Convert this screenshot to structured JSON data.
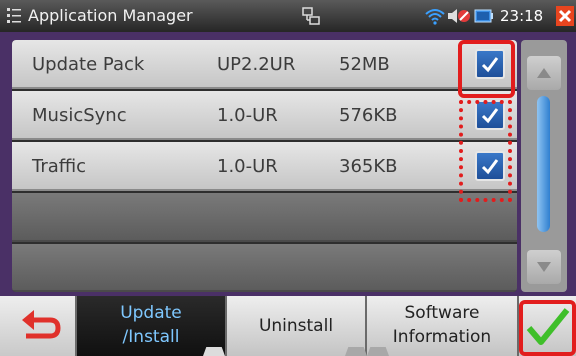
{
  "statusbar": {
    "title": "Application Manager",
    "clock": "23:18",
    "icons": [
      "app-grid-icon",
      "network-icon",
      "wifi-icon",
      "volume-icon",
      "battery-icon",
      "close-icon"
    ]
  },
  "packages": [
    {
      "name": "Update Pack",
      "version": "UP2.2UR",
      "size": "52MB",
      "checked": true
    },
    {
      "name": "MusicSync",
      "version": "1.0-UR",
      "size": "576KB",
      "checked": true
    },
    {
      "name": "Traffic",
      "version": "1.0-UR",
      "size": "365KB",
      "checked": true
    }
  ],
  "bottombar": {
    "tabs": [
      {
        "line1": "Update",
        "line2": "/Install",
        "active": true
      },
      {
        "line1": "Uninstall",
        "line2": "",
        "active": false
      },
      {
        "line1": "Software",
        "line2": "Information",
        "active": false
      }
    ],
    "icons": [
      "back-arrow-icon",
      "checkmark-icon"
    ]
  },
  "colors": {
    "accent_blue": "#2f7fd0",
    "highlight_red": "#e21d1d",
    "ok_green": "#3fbf2a",
    "back_red": "#e0312b",
    "frame_purple": "#4a3066"
  }
}
